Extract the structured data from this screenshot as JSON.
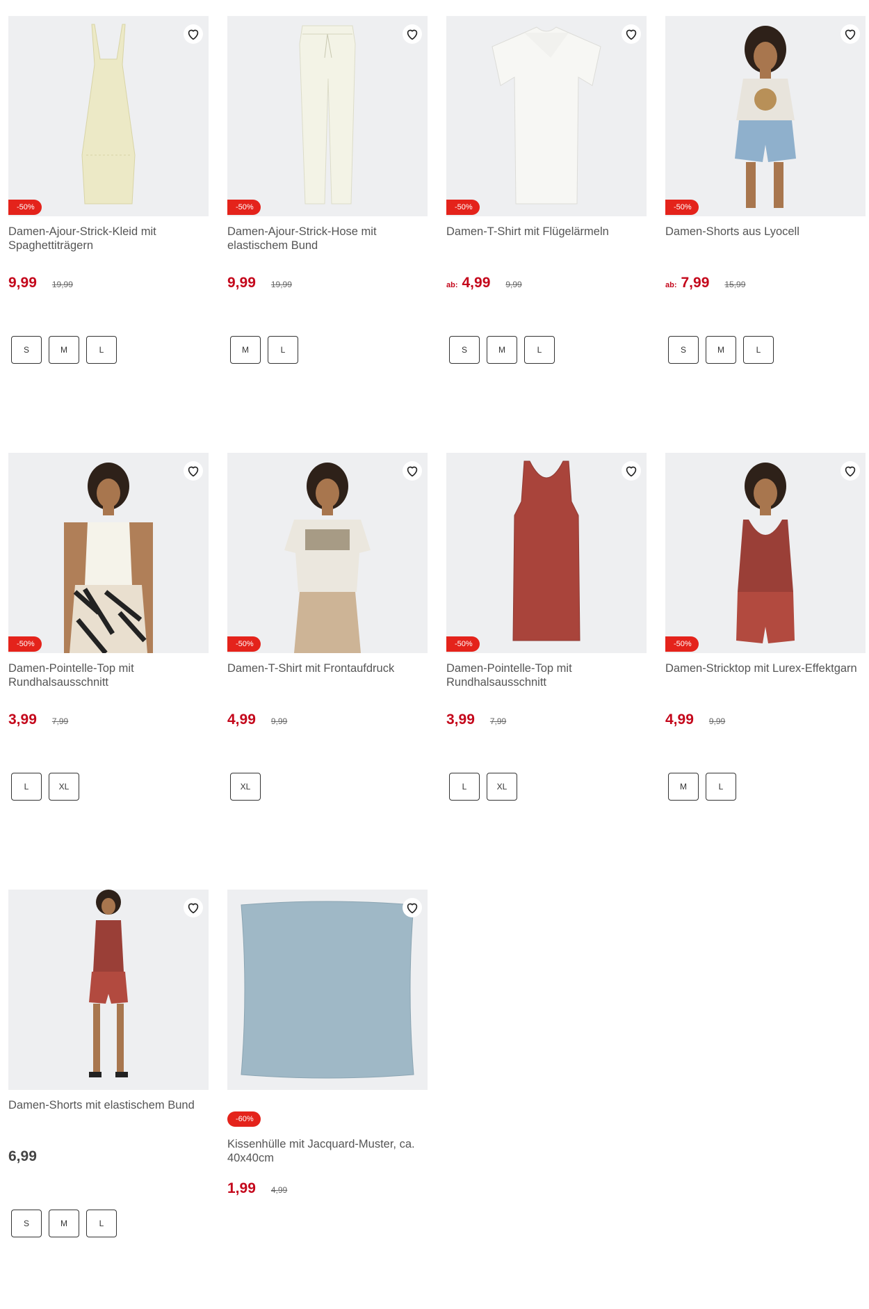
{
  "products": [
    {
      "title": "Damen-Ajour-Strick-Kleid mit Spaghettiträgern",
      "badge": "-50%",
      "price_prefix": "",
      "price": "9,99",
      "old_price": "19,99",
      "sizes": [
        "S",
        "M",
        "L"
      ],
      "image": "dress"
    },
    {
      "title": "Damen-Ajour-Strick-Hose mit elastischem Bund",
      "badge": "-50%",
      "price_prefix": "",
      "price": "9,99",
      "old_price": "19,99",
      "sizes": [
        "M",
        "L"
      ],
      "image": "pants"
    },
    {
      "title": "Damen-T-Shirt mit Flügelärmeln",
      "badge": "-50%",
      "price_prefix": "ab:",
      "price": "4,99",
      "old_price": "9,99",
      "sizes": [
        "S",
        "M",
        "L"
      ],
      "image": "ruffle-tee"
    },
    {
      "title": "Damen-Shorts aus Lyocell",
      "badge": "-50%",
      "price_prefix": "ab:",
      "price": "7,99",
      "old_price": "15,99",
      "sizes": [
        "S",
        "M",
        "L"
      ],
      "image": "model-denim-shorts"
    },
    {
      "title": "Damen-Pointelle-Top mit Rundhalsausschnitt",
      "badge": "-50%",
      "price_prefix": "",
      "price": "3,99",
      "old_price": "7,99",
      "sizes": [
        "L",
        "XL"
      ],
      "image": "model-white-top"
    },
    {
      "title": "Damen-T-Shirt mit Frontaufdruck",
      "badge": "-50%",
      "price_prefix": "",
      "price": "4,99",
      "old_price": "9,99",
      "sizes": [
        "XL"
      ],
      "image": "model-print-tee"
    },
    {
      "title": "Damen-Pointelle-Top mit Rundhalsausschnitt",
      "badge": "-50%",
      "price_prefix": "",
      "price": "3,99",
      "old_price": "7,99",
      "sizes": [
        "L",
        "XL"
      ],
      "image": "rust-tank"
    },
    {
      "title": "Damen-Stricktop mit Lurex-Effektgarn",
      "badge": "-50%",
      "price_prefix": "",
      "price": "4,99",
      "old_price": "9,99",
      "sizes": [
        "M",
        "L"
      ],
      "image": "model-rust-top"
    },
    {
      "title": "Damen-Shorts mit elastischem Bund",
      "badge": "",
      "price_prefix": "",
      "price": "6,99",
      "old_price": "",
      "sizes": [
        "S",
        "M",
        "L"
      ],
      "image": "model-rust-full"
    },
    {
      "title": "Kissenhülle mit Jacquard-Muster, ca. 40x40cm",
      "badge": "-60%",
      "price_prefix": "",
      "price": "1,99",
      "old_price": "4,99",
      "sizes": [],
      "image": "cushion"
    }
  ],
  "colors": {
    "sale_red": "#c4071b",
    "badge_red": "#e4231b",
    "image_bg": "#eeeff1"
  },
  "icons": {
    "wishlist": "heart-outline-icon"
  }
}
